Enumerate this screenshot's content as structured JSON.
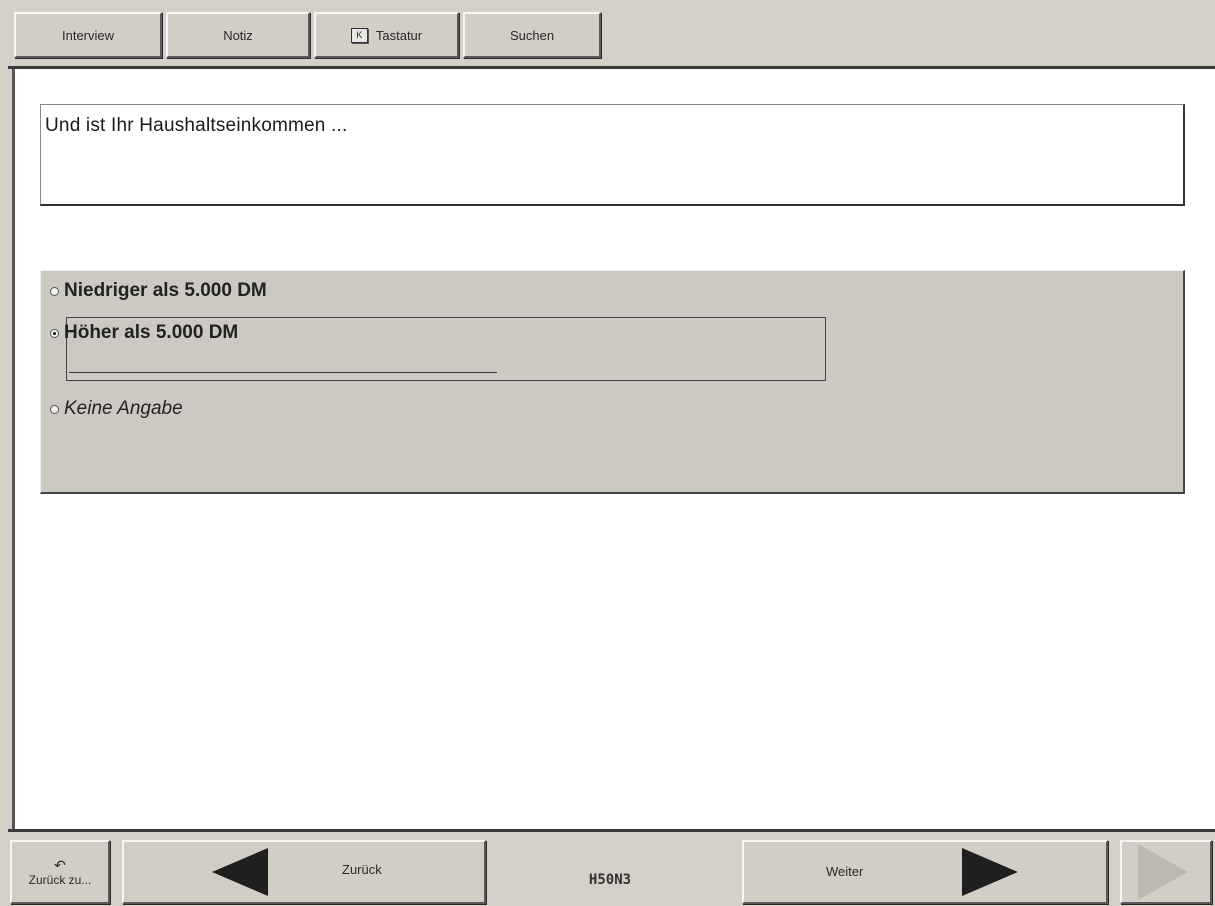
{
  "toolbar": {
    "interview": "Interview",
    "notiz": "Notiz",
    "tastatur_icon": "K",
    "tastatur": "Tastatur",
    "suchen": "Suchen"
  },
  "question": {
    "text": "Und ist Ihr Haushaltseinkommen ..."
  },
  "answers": [
    {
      "label": "Niedriger als 5.000 DM",
      "selected": false
    },
    {
      "label": "Höher als 5.000 DM",
      "selected": true
    },
    {
      "label": "Keine Angabe",
      "selected": false
    }
  ],
  "nav": {
    "back_to_icon": "↶",
    "back_to": "Zurück zu...",
    "back": "Zurück",
    "code": "H50N3",
    "next": "Weiter"
  }
}
